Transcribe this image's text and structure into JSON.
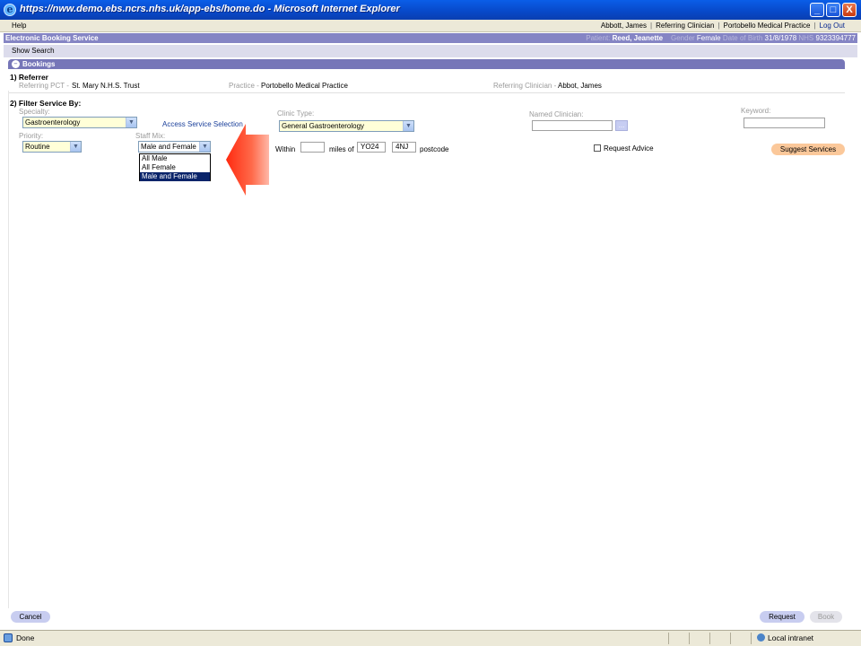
{
  "window": {
    "title": "https://nww.demo.ebs.ncrs.nhs.uk/app-ebs/home.do - Microsoft Internet Explorer",
    "minimize": "_",
    "maximize": "□",
    "close": "X"
  },
  "menubar": {
    "help": "Help",
    "user": "Abbott, James",
    "role": "Referring Clinician",
    "practice": "Portobello Medical Practice",
    "logout": "Log Out",
    "separator": "|"
  },
  "header": {
    "app_name": "Electronic Booking Service",
    "patient_label": "Patient:",
    "patient_name": "Reed, Jeanette",
    "gender_label": "Gender",
    "gender": "Female",
    "dob_label": "Date of Birth",
    "dob": "31/8/1978",
    "nhs_label": "NHS",
    "nhs_number": "9323394777"
  },
  "show_search": "Show Search",
  "bookings": {
    "title": "Bookings",
    "toggle": "–"
  },
  "referrer": {
    "title": "1) Referrer",
    "pct_label": "Referring PCT -",
    "pct": "St. Mary N.H.S. Trust",
    "practice_label": "Practice -",
    "practice": "Portobello Medical Practice",
    "clinician_label": "Referring Clinician -",
    "clinician": "Abbot, James"
  },
  "filter": {
    "title": "2) Filter Service By:",
    "specialty_label": "Specialty:",
    "specialty": "Gastroenterology",
    "access_link": "Access Service Selection",
    "clinic_type_label": "Clinic Type:",
    "clinic_type": "General Gastroenterology",
    "named_clinician_label": "Named Clinician:",
    "named_clinician": "",
    "named_clinician_button": "...",
    "keyword_label": "Keyword:",
    "keyword": "",
    "priority_label": "Priority:",
    "priority": "Routine",
    "staff_mix_label": "Staff Mix:",
    "staff_mix": "Male and Female",
    "staff_mix_options": [
      "All Male",
      "All Female",
      "Male and Female"
    ],
    "within_label": "Within",
    "within_value": "",
    "miles_of_label": "miles of",
    "postcode_part1": "YO24",
    "postcode_part2": "4NJ",
    "postcode_label": "postcode",
    "request_advice_label": "Request Advice",
    "suggest_button": "Suggest Services"
  },
  "footer": {
    "cancel": "Cancel",
    "request": "Request",
    "book": "Book"
  },
  "status": {
    "text": "Done",
    "zone": "Local intranet"
  },
  "colors": {
    "titlebar": "#0848c8",
    "ebs_header": "#8585c4",
    "bookings_header": "#7676b8",
    "arrow_red": "#ff5a3c",
    "suggest_orange": "#fbc89a"
  }
}
